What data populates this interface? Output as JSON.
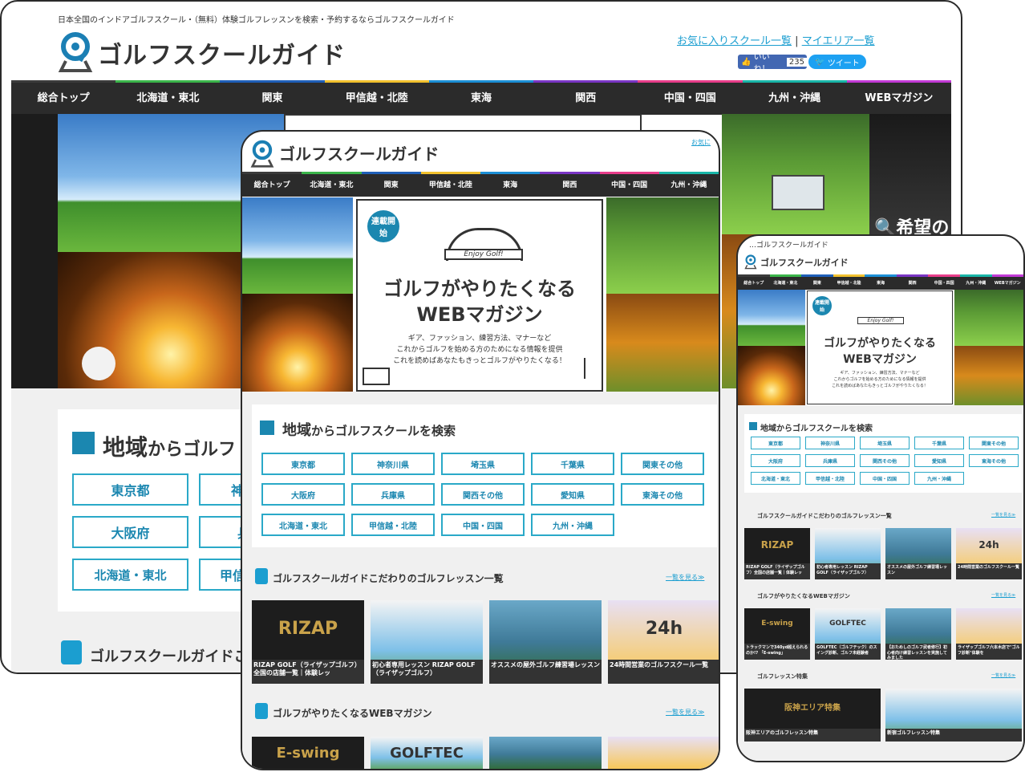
{
  "brand": "ゴルフスクールガイド",
  "tagline": "日本全国のインドアゴルフスクール・（無料）体験ゴルフレッスンを検索・予約するならゴルフスクールガイド",
  "links": {
    "favorites": "お気に入りスクール一覧",
    "my_area": "マイエリア一覧",
    "sep": "|",
    "fav_short": "お気に"
  },
  "social": {
    "like": "いいね！",
    "like_count": "235",
    "tweet": "ツイート"
  },
  "nav": [
    "総合トップ",
    "北海道・東北",
    "関東",
    "甲信越・北陸",
    "東海",
    "関西",
    "中国・四国",
    "九州・沖縄",
    "WEBマガジン"
  ],
  "nav_colors": [
    "#3b3b3b",
    "#3bb54a",
    "#1f5fb8",
    "#f2c12e",
    "#1c8fd6",
    "#7a35c4",
    "#e83d8a",
    "#19b6a8",
    "#c23ad6"
  ],
  "search_hint": "希望の",
  "magazine": {
    "badge": "連載開始",
    "logo": "Enjoy Golf!",
    "title_line1": "ゴルフがやりたくなる",
    "title_line2": "WEBマガジン",
    "desc1": "ギア、ファッション、練習方法、マナーなど",
    "desc2": "これからゴルフを始める方のためになる情報を提供",
    "desc3": "これを読めばあなたもきっとゴルフがやりたくなる！"
  },
  "region_search": {
    "title_big": "地域",
    "title_rest": "からゴルフスクールを検索",
    "title_cut": "からゴルフ"
  },
  "regions": [
    "東京都",
    "神奈川県",
    "埼玉県",
    "千葉県",
    "関東その他",
    "大阪府",
    "兵庫県",
    "関西その他",
    "愛知県",
    "東海その他",
    "北海道・東北",
    "甲信越・北陸",
    "中国・四国",
    "九州・沖縄"
  ],
  "desk_cut_regions": [
    "神",
    "兵",
    "甲信"
  ],
  "sections": {
    "lessons": "ゴルフスクールガイドこだわりのゴルフレッスン一覧",
    "lessons_cut": "ゴルフスクールガイドこ",
    "magazine": "ゴルフがやりたくなるWEBマガジン",
    "features": "ゴルフレッスン特集",
    "more": "一覧を見る≫"
  },
  "lessons": [
    {
      "caption": "RIZAP GOLF（ライザップゴルフ）全国の店舗一覧｜体験レッ",
      "label": "RIZAP",
      "icon": "rizap-logo"
    },
    {
      "caption": "初心者専用レッスン RIZAP GOLF（ライザップゴルフ）",
      "icon": "indoor-golf-photo"
    },
    {
      "caption": "オススメの屋外ゴルフ練習場レッスン",
      "icon": "driving-range-photo"
    },
    {
      "caption": "24時間営業のゴルフスクール一覧",
      "label": "24h",
      "icon": "clock-24h-icon"
    }
  ],
  "magazine_items": [
    {
      "caption": "トラックマンで340yd超えられるのか!? 「E-swing」",
      "label": "E-swing"
    },
    {
      "caption": "GOLFTEC（ゴルフテック）のスイング診断、ゴルフ未経験者",
      "label": "GOLFTEC",
      "sub": "by GDO"
    },
    {
      "caption": "【おためしのゴルフ武者修行】初心者向け練習レッスンを実施してみました"
    },
    {
      "caption": "ライザップゴルフ六本木店で\"ゴルフ診断\"体験を"
    }
  ],
  "features": [
    {
      "caption": "阪神エリアのゴルフレッスン特集",
      "label": "阪神エリア特集"
    },
    {
      "caption": "新宿ゴルフレッスン特集"
    }
  ],
  "phone_tagline": "…ゴルフスクールガイド"
}
